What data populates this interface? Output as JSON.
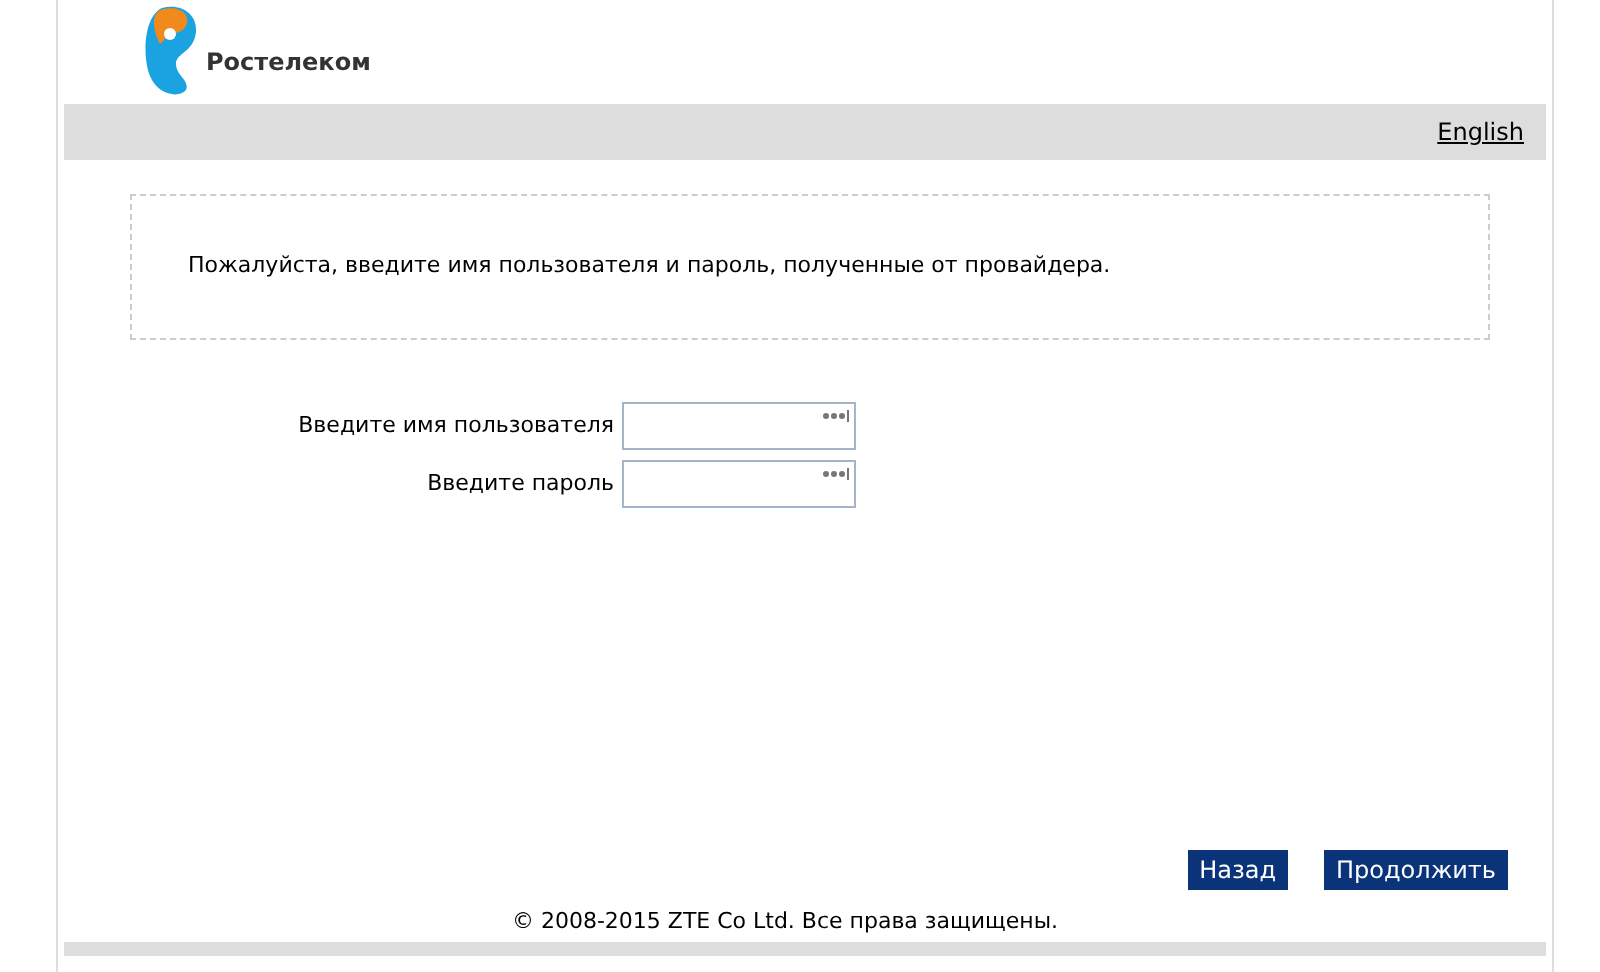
{
  "header": {
    "logo_text": "Ростелеком"
  },
  "language_link": "English",
  "notice": "Пожалуйста, введите имя пользователя и пароль, полученные от провайдера.",
  "fields": [
    {
      "label": "Введите имя пользователя"
    },
    {
      "label": "Введите пароль"
    }
  ],
  "buttons": [
    "Назад",
    "Продолжить"
  ],
  "footer": "© 2008-2015 ZTE Co Ltd. Все права защищены."
}
